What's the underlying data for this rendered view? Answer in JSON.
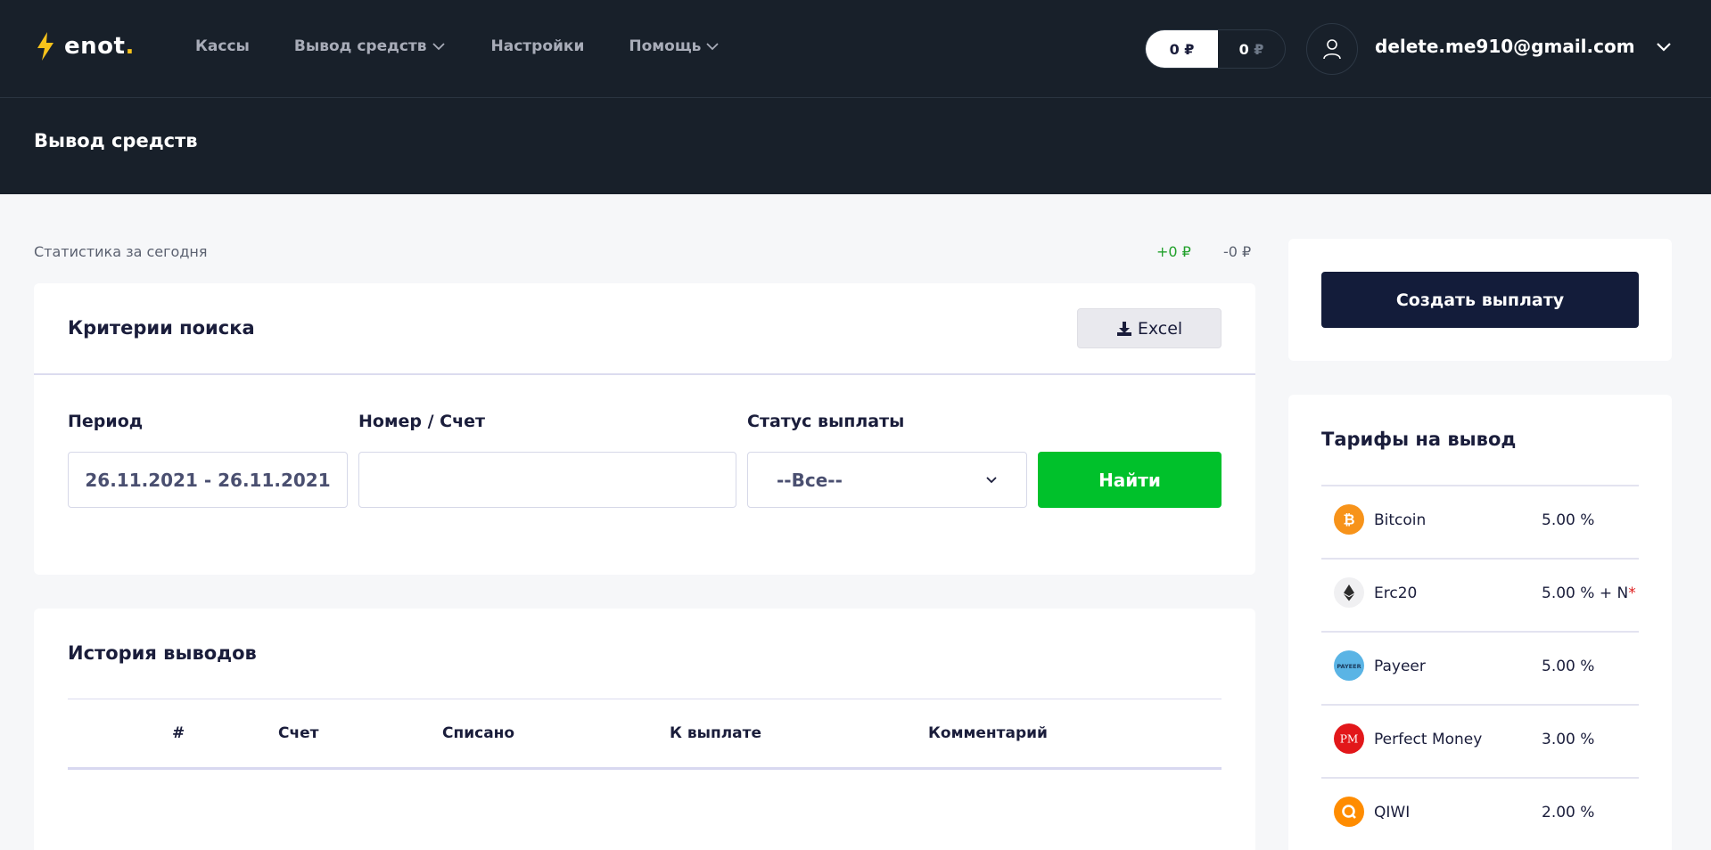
{
  "header": {
    "logo_text": "enot",
    "logo_dot": ".",
    "nav": [
      {
        "label": "Кассы",
        "has_dropdown": false
      },
      {
        "label": "Вывод средств",
        "has_dropdown": true
      },
      {
        "label": "Настройки",
        "has_dropdown": false
      },
      {
        "label": "Помощь",
        "has_dropdown": true
      }
    ],
    "balances": [
      {
        "amount": "0",
        "currency": "₽"
      },
      {
        "amount": "0",
        "currency": "₽"
      }
    ],
    "user_email": "delete.me910@gmail.com"
  },
  "page": {
    "title": "Вывод средств"
  },
  "stats": {
    "label": "Статистика за сегодня",
    "plus": "+0 ₽",
    "minus": "-0 ₽"
  },
  "search": {
    "title": "Критерии поиска",
    "excel_label": "Excel",
    "period_label": "Период",
    "period_value": "26.11.2021 - 26.11.2021",
    "number_label": "Номер / Счет",
    "number_value": "",
    "status_label": "Статус выплаты",
    "status_value": "--Все--",
    "find_label": "Найти"
  },
  "history": {
    "title": "История выводов",
    "columns": [
      "#",
      "Счет",
      "Списано",
      "К выплате",
      "Комментарий"
    ]
  },
  "create_payout_label": "Создать выплату",
  "tariffs": {
    "title": "Тарифы на вывод",
    "items": [
      {
        "name": "Bitcoin",
        "fee": "5.00 %",
        "fee_suffix": "",
        "icon": "bitcoin-icon",
        "color": "#f7931a"
      },
      {
        "name": "Erc20",
        "fee": "5.00 % + N",
        "fee_suffix": "*",
        "icon": "ethereum-icon",
        "color": "#f0f0f2"
      },
      {
        "name": "Payeer",
        "fee": "5.00 %",
        "fee_suffix": "",
        "icon": "payeer-icon",
        "color": "#5ab4e5"
      },
      {
        "name": "Perfect Money",
        "fee": "3.00 %",
        "fee_suffix": "",
        "icon": "perfect-money-icon",
        "color": "#e2171a"
      },
      {
        "name": "QIWI",
        "fee": "2.00 %",
        "fee_suffix": "",
        "icon": "qiwi-icon",
        "color": "#ff8c00"
      }
    ]
  },
  "colors": {
    "header_bg": "#18202a",
    "accent_green": "#00c12b",
    "primary_navy": "#131c3a",
    "logo_yellow": "#f7c21b"
  }
}
